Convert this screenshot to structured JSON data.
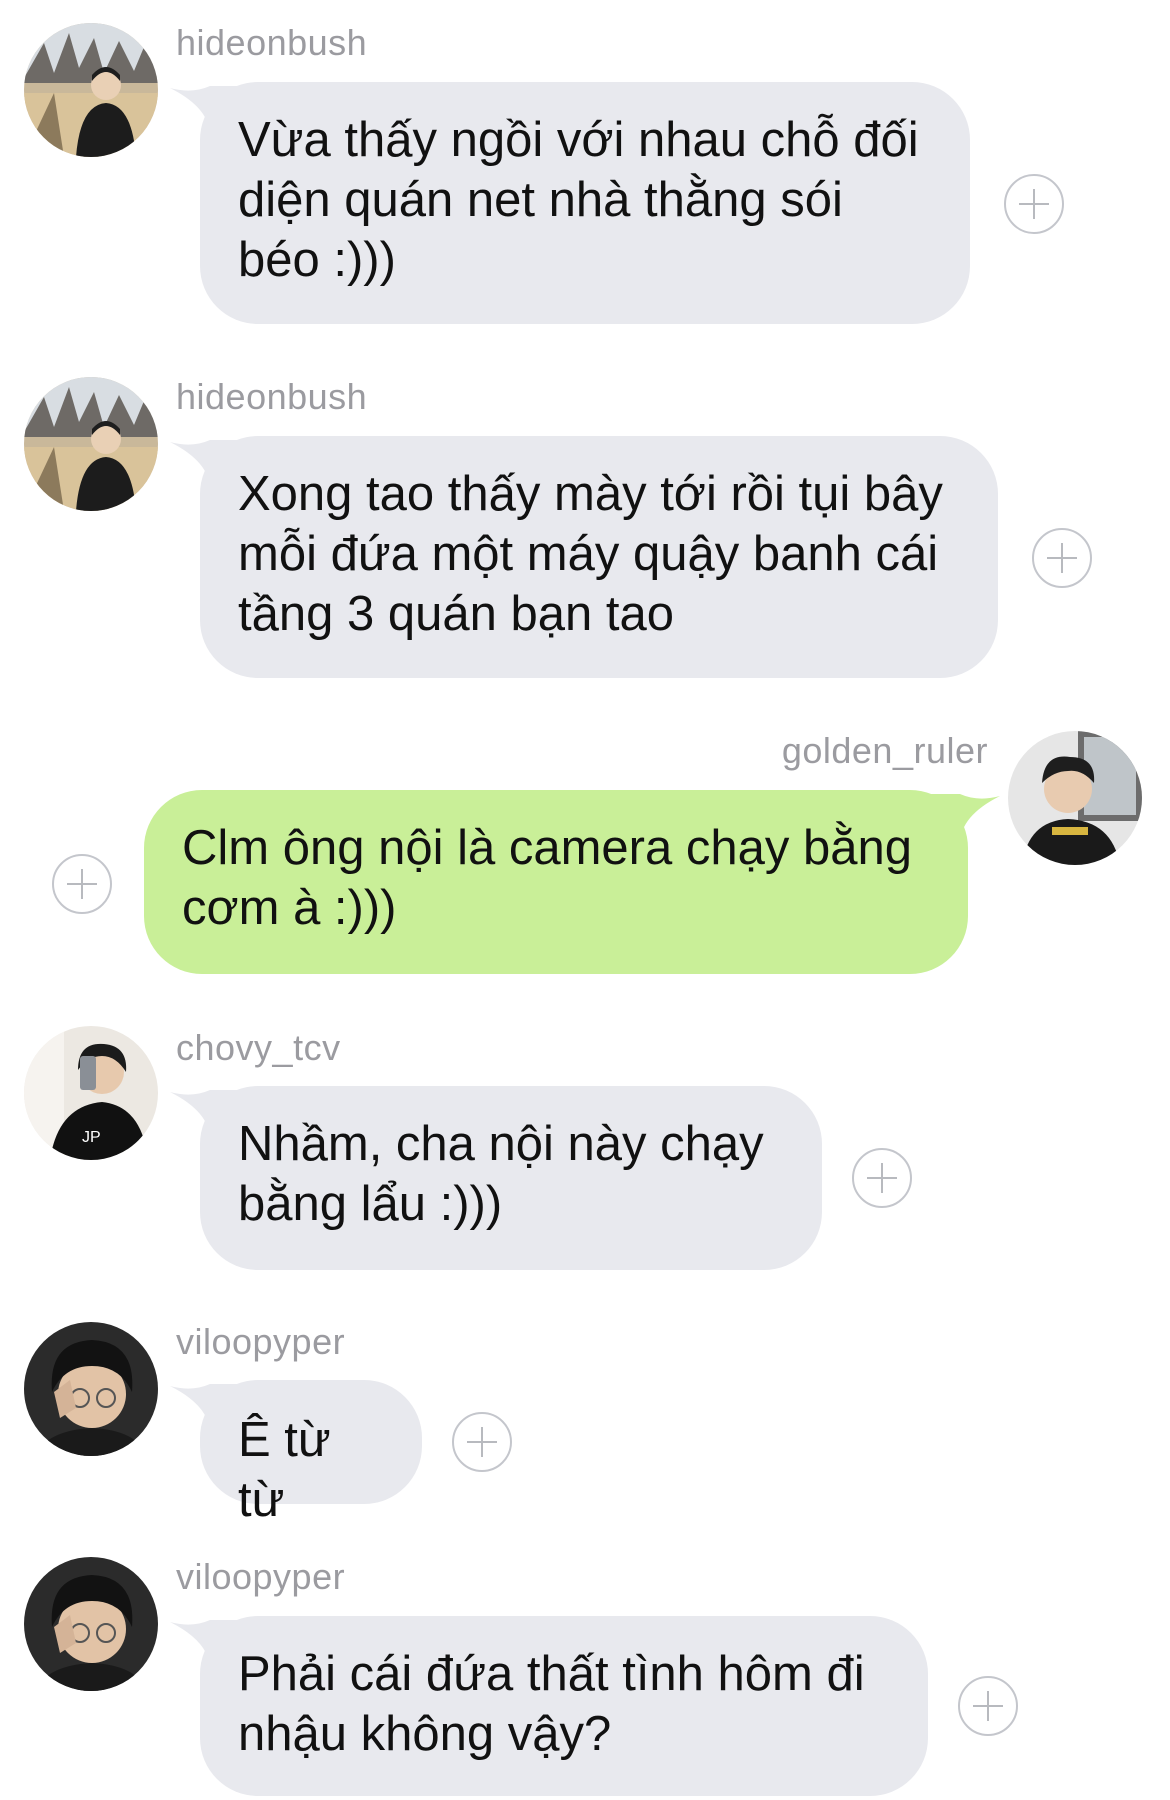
{
  "messages": [
    {
      "username": "hideonbush",
      "direction": "incoming",
      "text": "Vừa thấy ngồi với nhau chỗ đối\ndiện quán net nhà thằng sói\nbéo :)))",
      "avatar_icon": "profile-photo-icon"
    },
    {
      "username": "hideonbush",
      "direction": "incoming",
      "text": "Xong tao thấy mày tới rồi tụi bây\nmỗi đứa một máy quậy banh cái\ntầng 3 quán bạn tao",
      "avatar_icon": "profile-photo-icon"
    },
    {
      "username": "golden_ruler",
      "direction": "outgoing",
      "text": "Clm ông nội là camera chạy bằng\ncơm à :)))",
      "avatar_icon": "profile-photo-icon"
    },
    {
      "username": "chovy_tcv",
      "direction": "incoming",
      "text": "Nhầm, cha nội này chạy\nbằng lẩu :)))",
      "avatar_icon": "profile-photo-icon"
    },
    {
      "username": "viloopyper",
      "direction": "incoming",
      "text": "Ê từ từ",
      "avatar_icon": "profile-photo-icon"
    },
    {
      "username": "viloopyper",
      "direction": "incoming",
      "text": "Phải cái đứa thất tình hôm đi\nnhậu không vậy?",
      "avatar_icon": "profile-photo-icon"
    }
  ],
  "colors": {
    "incoming_bubble": "#e8e9ee",
    "outgoing_bubble": "#c9ef98",
    "username": "#9b9ba0",
    "background": "#ffffff"
  },
  "icons": {
    "reaction": "plus-circle-icon"
  }
}
